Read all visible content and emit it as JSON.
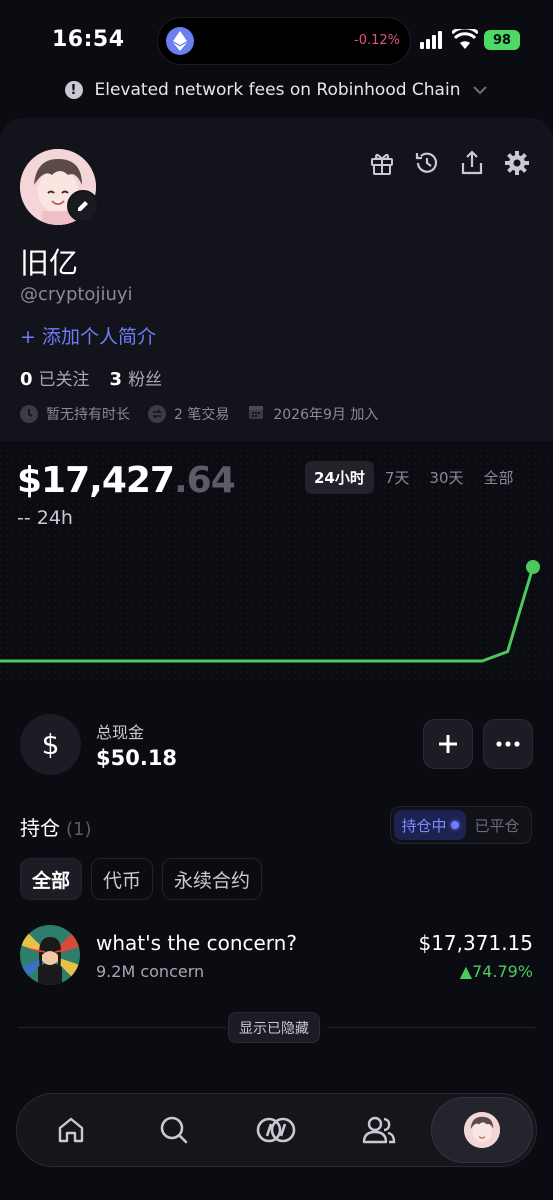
{
  "status_bar": {
    "time": "16:54",
    "island_change": "-0.12%",
    "battery": "98"
  },
  "banner": {
    "text": "Elevated network fees on Robinhood Chain"
  },
  "profile": {
    "display_name": "旧亿",
    "username": "@cryptojiuyi",
    "add_bio": "+ 添加个人简介",
    "following_count": "0",
    "following_label": "已关注",
    "followers_count": "3",
    "followers_label": "粉丝",
    "meta": {
      "holding_time": "暂无持有时长",
      "trades": "2 笔交易",
      "joined": "2026年9月 加入"
    }
  },
  "portfolio": {
    "balance_main": "$17,427",
    "balance_cents": ".64",
    "change_24h": "-- 24h",
    "range_tabs": [
      "24小时",
      "7天",
      "30天",
      "全部"
    ],
    "active_range": "24小时"
  },
  "chart_data": {
    "type": "line",
    "series": [
      {
        "values": [
          0,
          0,
          0,
          0,
          0,
          0,
          0,
          0,
          0,
          0,
          0,
          0,
          0,
          0,
          0,
          0,
          0,
          0,
          0,
          0,
          0.1,
          1
        ]
      }
    ],
    "ylim": [
      0,
      1
    ]
  },
  "cash": {
    "label": "总现金",
    "value": "$50.18",
    "icon": "dollar-icon"
  },
  "holdings": {
    "title": "持仓",
    "count": "(1)",
    "toggle_open": "持仓中",
    "toggle_closed": "已平仓",
    "filters": [
      "全部",
      "代币",
      "永续合约"
    ],
    "items": [
      {
        "name": "what's the concern?",
        "sub": "9.2M concern",
        "value": "$17,371.15",
        "change": "▲74.79%"
      }
    ],
    "show_hidden": "显示已隐藏"
  },
  "colors": {
    "accent": "#6e7cf8",
    "positive": "#4cc95d",
    "negative": "#e4508d",
    "background": "#0b0b12"
  }
}
